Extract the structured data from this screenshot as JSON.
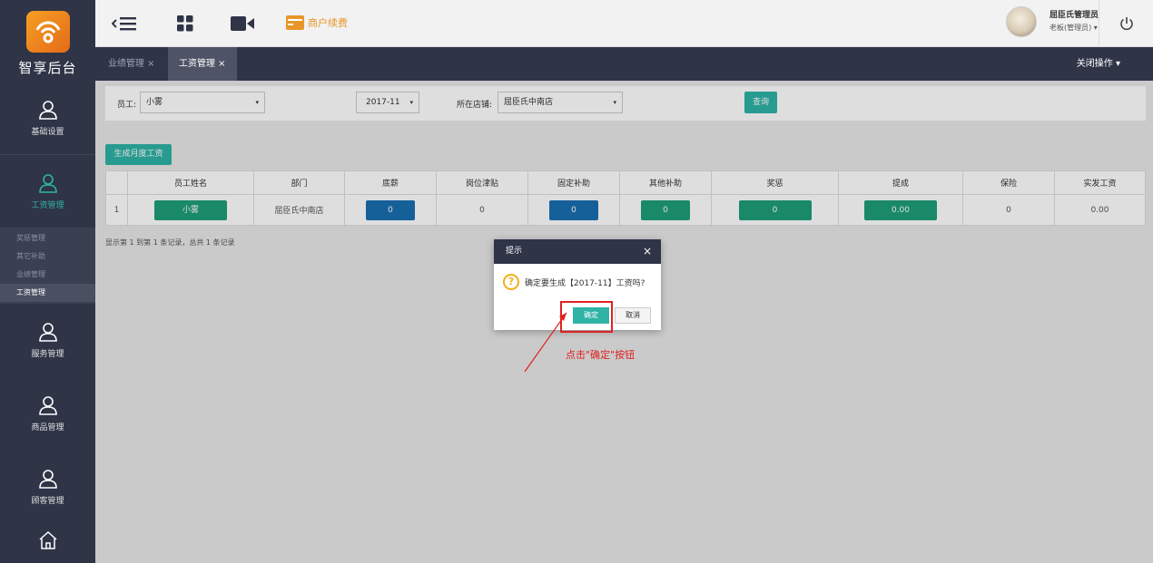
{
  "sidebar": {
    "logo_text": "智享后台",
    "items": [
      {
        "label": "基础设置"
      },
      {
        "label": "工资管理"
      },
      {
        "label": "服务管理"
      },
      {
        "label": "商品管理"
      },
      {
        "label": "顾客管理"
      }
    ],
    "submenu": [
      "奖惩管理",
      "其它补助",
      "业绩管理",
      "工资管理"
    ]
  },
  "topbar": {
    "renew_label": "商户续费",
    "user_name": "屈臣氏管理员",
    "user_role": "老板(管理员) ▾"
  },
  "tabs": [
    {
      "label": "业绩管理 ×"
    },
    {
      "label": "工资管理 ×"
    }
  ],
  "close_ops": "关闭操作 ▾",
  "filter": {
    "employee_label": "员工:",
    "employee_value": "小雾",
    "month_value": "2017-11",
    "store_label": "所在店铺:",
    "store_value": "屈臣氏中南店",
    "query_label": "查询"
  },
  "generate_label": "生成月度工资",
  "table": {
    "headers": [
      "",
      "员工姓名",
      "部门",
      "底薪",
      "岗位津贴",
      "固定补助",
      "其他补助",
      "奖惩",
      "提成",
      "保险",
      "实发工资"
    ],
    "rows": [
      [
        "1",
        "小雾",
        "屈臣氏中南店",
        "0",
        "0",
        "0",
        "0",
        "0",
        "0.00",
        "0",
        "0.00"
      ]
    ]
  },
  "pager_text": "显示第 1 到第 1 条记录，总共 1 条记录",
  "dialog": {
    "title": "提示",
    "close": "×",
    "message": "确定要生成【2017-11】工资吗?",
    "ok_label": "确定",
    "cancel_label": "取消"
  },
  "annotation": "点击\"确定\"按钮",
  "colors": {
    "accent": "#2fb3a6",
    "sidebar": "#2f3447",
    "blue": "#1a6fb0",
    "green": "#1e9e78",
    "annotation": "#e02020"
  }
}
